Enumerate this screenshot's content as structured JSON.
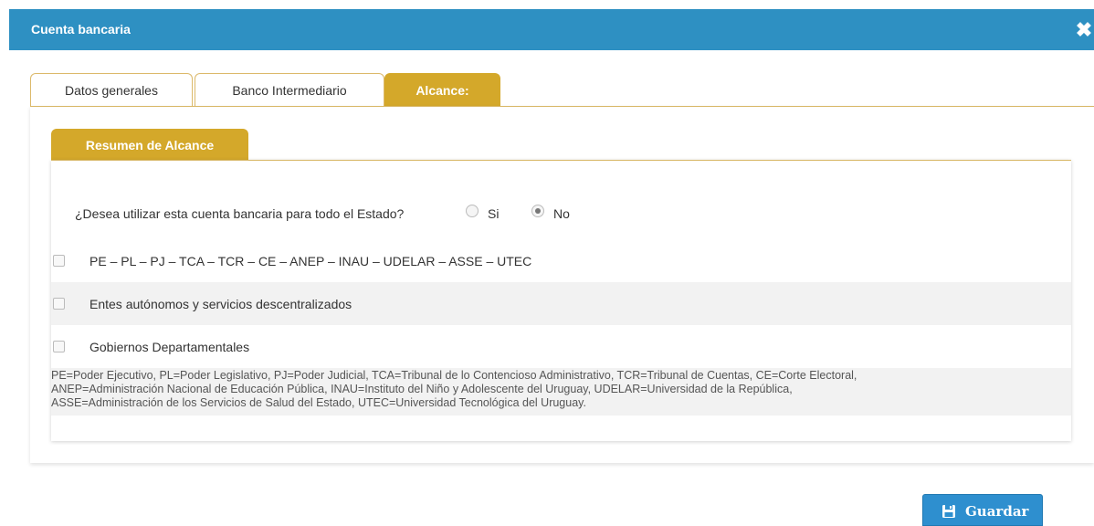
{
  "dialog": {
    "title": "Cuenta bancaria",
    "close_glyph": "✖"
  },
  "tabs": [
    {
      "label": "Datos generales"
    },
    {
      "label": "Banco Intermediario"
    },
    {
      "label": "Alcance:"
    }
  ],
  "subtab": {
    "label": "Resumen de Alcance"
  },
  "question": {
    "text": "¿Desea utilizar esta cuenta bancaria para todo el Estado?",
    "options": [
      {
        "label": "Si",
        "checked": false
      },
      {
        "label": "No",
        "checked": true
      }
    ]
  },
  "scopes": [
    {
      "label": "PE – PL – PJ – TCA – TCR – CE – ANEP – INAU – UDELAR – ASSE – UTEC",
      "checked": false
    },
    {
      "label": "Entes autónomos y servicios descentralizados",
      "checked": false
    },
    {
      "label": "Gobiernos Departamentales",
      "checked": false
    }
  ],
  "legend_lines": [
    "PE=Poder Ejecutivo, PL=Poder Legislativo, PJ=Poder Judicial, TCA=Tribunal de lo Contencioso Administrativo, TCR=Tribunal de Cuentas, CE=Corte Electoral,",
    "ANEP=Administración Nacional de Educación Pública, INAU=Instituto del Niño y Adolescente del Uruguay, UDELAR=Universidad de la República,",
    "ASSE=Administración de los Servicios de Salud del Estado, UTEC=Universidad Tecnológica del Uruguay."
  ],
  "footer": {
    "save_label": "Guardar",
    "save_icon": "floppy-disk-icon"
  },
  "colors": {
    "header": "#2e90c2",
    "tab_active": "#d4a82a",
    "button": "#2e8fcf"
  }
}
